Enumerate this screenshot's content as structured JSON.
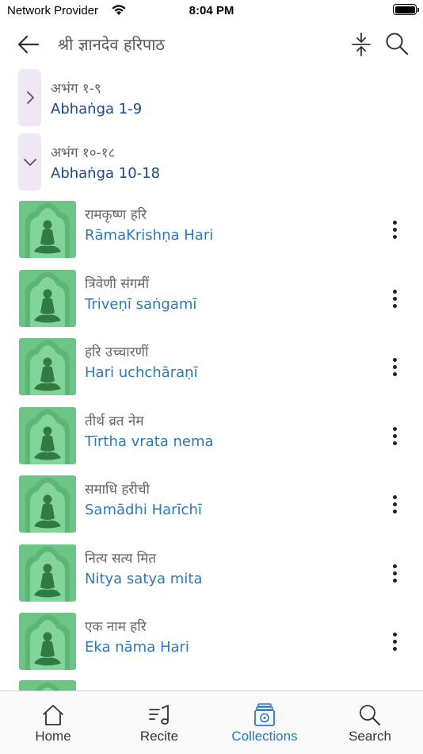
{
  "status_bar": {
    "carrier": "Network Provider",
    "time": "8:04 PM"
  },
  "nav": {
    "title": "श्री ज्ञानदेव हरिपाठ"
  },
  "sections": [
    {
      "deva": "अभंग १-९",
      "roman": "Abhaṅga 1-9",
      "expanded": false
    },
    {
      "deva": "अभंग १०-१८",
      "roman": "Abhaṅga 10-18",
      "expanded": true
    }
  ],
  "items": [
    {
      "deva": "रामकृष्ण हरि",
      "roman": "RāmaKrishṇa Hari"
    },
    {
      "deva": "त्रिवेणी संगमीं",
      "roman": "Triveṇī saṅgamī"
    },
    {
      "deva": "हरि उच्चारणीं",
      "roman": "Hari uchchāraṇī"
    },
    {
      "deva": "तीर्थ व्रत नेम",
      "roman": "Tīrtha vrata nema"
    },
    {
      "deva": "समाधि हरीची",
      "roman": "Samādhi Harīchī"
    },
    {
      "deva": "नित्य सत्य मित",
      "roman": "Nitya satya mita"
    },
    {
      "deva": "एक नाम हरि",
      "roman": "Eka nāma Hari"
    }
  ],
  "tabs": [
    {
      "label": "Home",
      "icon": "home-icon",
      "active": false
    },
    {
      "label": "Recite",
      "icon": "music-notes-icon",
      "active": false
    },
    {
      "label": "Collections",
      "icon": "collections-icon",
      "active": true
    },
    {
      "label": "Search",
      "icon": "search-icon",
      "active": false
    }
  ],
  "colors": {
    "accent": "#2a79bd",
    "section_text": "#1b4a86",
    "section_bg": "#efe7f3",
    "thumb_bg": "#6cc485",
    "thumb_figure": "#2f7a45"
  }
}
